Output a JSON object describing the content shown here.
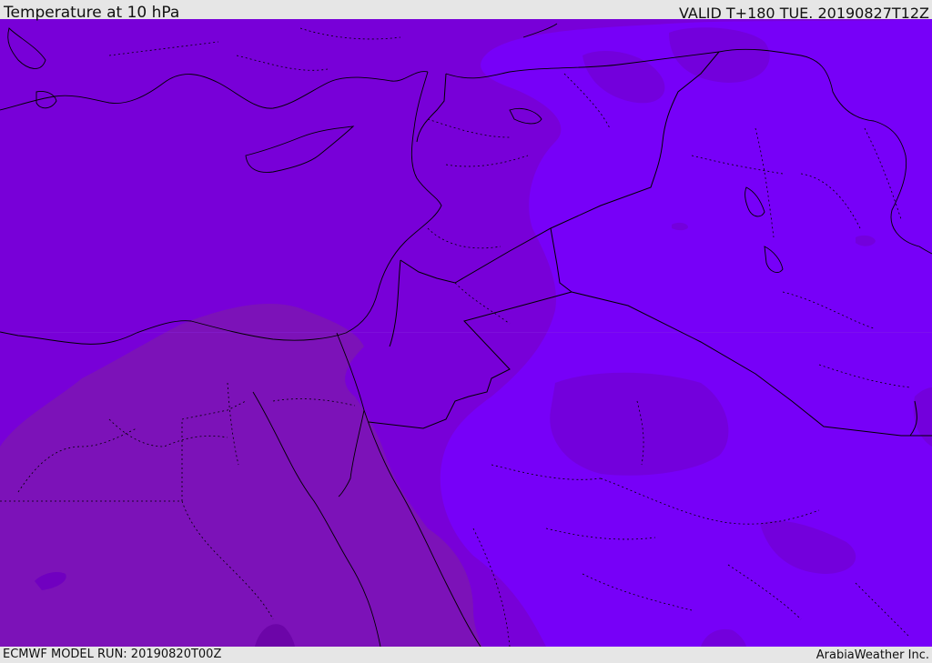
{
  "header": {
    "title": "Temperature at 10 hPa",
    "valid": "VALID T+180 TUE. 20190827T12Z"
  },
  "footer": {
    "model_run": "ECMWF MODEL RUN: 20190820T00Z",
    "credit": "ArabiaWeather Inc."
  },
  "map": {
    "colors": {
      "west_field": "#7800d8",
      "east_field": "#7700f8",
      "southwest_field": "#7c12b8",
      "cold_patch": "#7300dc",
      "borders": "#000000",
      "coast": "#000000"
    }
  }
}
